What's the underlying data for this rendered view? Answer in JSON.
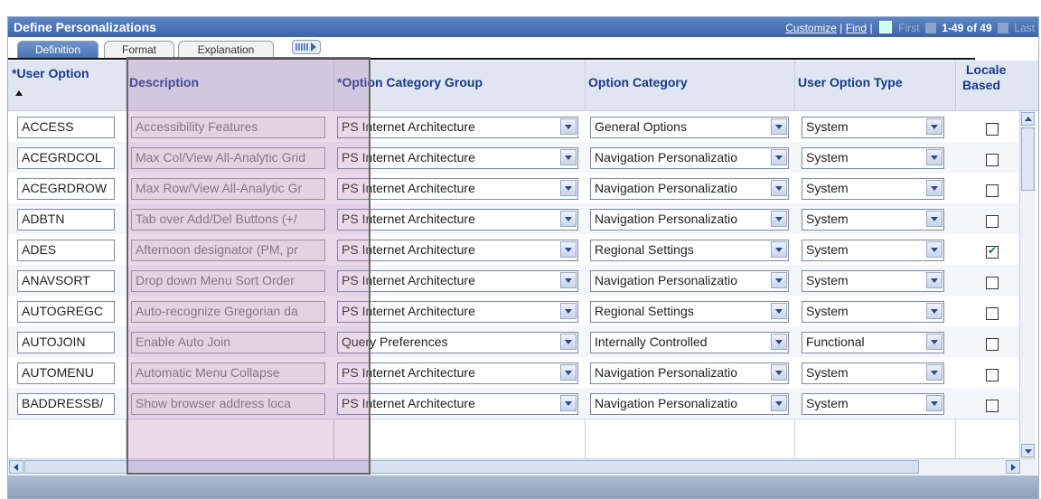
{
  "title": "Define Personalizations",
  "nav": {
    "customize": "Customize",
    "separator1": "|",
    "find": "Find",
    "separator2": "|",
    "first": "First",
    "range": "1-49 of 49",
    "last": "Last"
  },
  "tabs": [
    {
      "label": "Definition",
      "active": true
    },
    {
      "label": "Format",
      "active": false
    },
    {
      "label": "Explanation",
      "active": false
    }
  ],
  "columns": {
    "user_option": "*User Option",
    "description": "Description",
    "option_category_group": "*Option Category Group",
    "option_category": "Option Category",
    "user_option_type": "User Option Type",
    "locale_based_line1": "Locale",
    "locale_based_line2": "Based"
  },
  "rows": [
    {
      "user_option": "ACCESS",
      "description": "Accessibility Features",
      "group": "PS Internet Architecture",
      "category": "General Options",
      "type": "System",
      "locale_based": false
    },
    {
      "user_option": "ACEGRDCOL",
      "description": "Max Col/View All-Analytic Grid",
      "group": "PS Internet Architecture",
      "category": "Navigation Personalizatio",
      "type": "System",
      "locale_based": false
    },
    {
      "user_option": "ACEGRDROW",
      "description": "Max Row/View All-Analytic Gr",
      "group": "PS Internet Architecture",
      "category": "Navigation Personalizatio",
      "type": "System",
      "locale_based": false
    },
    {
      "user_option": "ADBTN",
      "description": "Tab over Add/Del Buttons (+/",
      "group": "PS Internet Architecture",
      "category": "Navigation Personalizatio",
      "type": "System",
      "locale_based": false
    },
    {
      "user_option": "ADES",
      "description": "Afternoon designator (PM, pr",
      "group": "PS Internet Architecture",
      "category": "Regional Settings",
      "type": "System",
      "locale_based": true
    },
    {
      "user_option": "ANAVSORT",
      "description": "Drop down Menu Sort Order",
      "group": "PS Internet Architecture",
      "category": "Navigation Personalizatio",
      "type": "System",
      "locale_based": false
    },
    {
      "user_option": "AUTOGREGC",
      "description": "Auto-recognize Gregorian da",
      "group": "PS Internet Architecture",
      "category": "Regional Settings",
      "type": "System",
      "locale_based": false
    },
    {
      "user_option": "AUTOJOIN",
      "description": "Enable Auto Join",
      "group": "Query Preferences",
      "category": "Internally Controlled",
      "type": "Functional",
      "locale_based": false
    },
    {
      "user_option": "AUTOMENU",
      "description": "Automatic Menu Collapse",
      "group": "PS Internet Architecture",
      "category": "Navigation Personalizatio",
      "type": "System",
      "locale_based": false
    },
    {
      "user_option": "BADDRESSB/",
      "description": "Show browser address loca",
      "group": "PS Internet Architecture",
      "category": "Navigation Personalizatio",
      "type": "System",
      "locale_based": false
    }
  ]
}
